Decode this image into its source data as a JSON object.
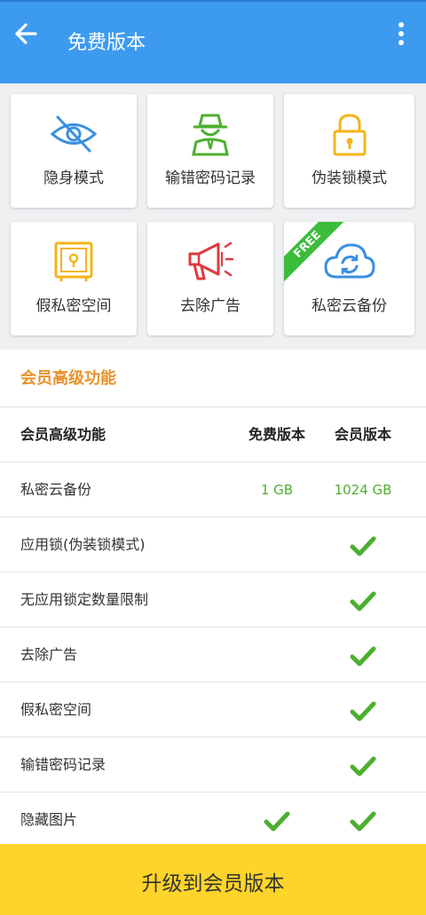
{
  "header": {
    "title": "免费版本",
    "back_icon": "arrow-left-icon",
    "more_icon": "more-vert-icon",
    "color": "#3d9bef"
  },
  "features": [
    {
      "label": "隐身模式",
      "icon": "eye-off-icon"
    },
    {
      "label": "输错密码记录",
      "icon": "spy-icon"
    },
    {
      "label": "伪装锁模式",
      "icon": "padlock-icon"
    },
    {
      "label": "假私密空间",
      "icon": "safe-icon"
    },
    {
      "label": "去除广告",
      "icon": "megaphone-icon"
    },
    {
      "label": "私密云备份",
      "icon": "cloud-sync-icon",
      "badge": "FREE"
    }
  ],
  "section_title": "会员高级功能",
  "table": {
    "headers": {
      "feature": "会员高级功能",
      "free": "免费版本",
      "vip": "会员版本"
    },
    "rows": [
      {
        "name": "私密云备份",
        "free": "1 GB",
        "vip": "1024 GB"
      },
      {
        "name": "应用锁(伪装锁模式)",
        "free_check": false,
        "vip_check": true
      },
      {
        "name": "无应用锁定数量限制",
        "free_check": false,
        "vip_check": true
      },
      {
        "name": "去除广告",
        "free_check": false,
        "vip_check": true
      },
      {
        "name": "假私密空间",
        "free_check": false,
        "vip_check": true
      },
      {
        "name": "输错密码记录",
        "free_check": false,
        "vip_check": true
      },
      {
        "name": "隐藏图片",
        "free_check": true,
        "vip_check": true
      }
    ]
  },
  "upgrade_button": {
    "label": "升级到会员版本",
    "color": "#ffd42a"
  },
  "colors": {
    "accent_orange": "#e8922c",
    "check_green": "#4caf2f"
  }
}
